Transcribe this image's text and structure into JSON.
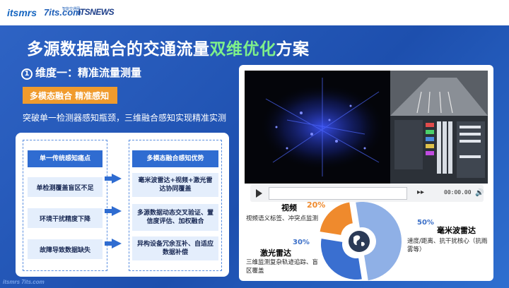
{
  "logos": {
    "itsmrs": "itsmrs",
    "its_com": "7its.com",
    "its_com_small": "智能交通网",
    "itsnews": "ITSNEWS"
  },
  "title": {
    "main": "多源数据融合的交通流量",
    "highlight": "双维优化",
    "suffix": "方案"
  },
  "dimension": {
    "num": "1",
    "label": "维度一：精准流量测量"
  },
  "tag": "多模态融合  精准感知",
  "subtitle": "突破单一检测器感知瓶颈，三维融合感知实现精准实测",
  "comparison": {
    "left_header": "单一传统感知痛点",
    "left_items": [
      "单检测覆盖盲区不足",
      "环境干扰精度下降",
      "故障导致数据缺失"
    ],
    "right_header": "多模态融合感知优势",
    "right_items": [
      "毫米波雷达+视频+激光雷达协同覆盖",
      "多源数据动态交叉验证、置信度评估、加权融合",
      "异构设备冗余互补、自适应数据补偿"
    ]
  },
  "player": {
    "time": "00:00.00"
  },
  "diagram": {
    "segments": [
      {
        "name": "视频",
        "percent": "20%",
        "desc": "视频语义标签、冲突点监测",
        "color": "#ef8a2d",
        "value": 20
      },
      {
        "name": "毫米波雷达",
        "percent": "50%",
        "desc": "速度/距离、抗干扰核心（抗雨雾等）",
        "color": "#8fb0e6",
        "value": 50
      },
      {
        "name": "激光雷达",
        "percent": "30%",
        "desc": "三维监测复杂轨迹追踪、盲区覆盖",
        "color": "#3a6fd0",
        "value": 30
      }
    ],
    "colors": {
      "radar": "#6f97dc",
      "laser": "#2b5bc2",
      "video": "#ef8a2d"
    }
  },
  "footer_logo": "itsmrs  7its.com"
}
